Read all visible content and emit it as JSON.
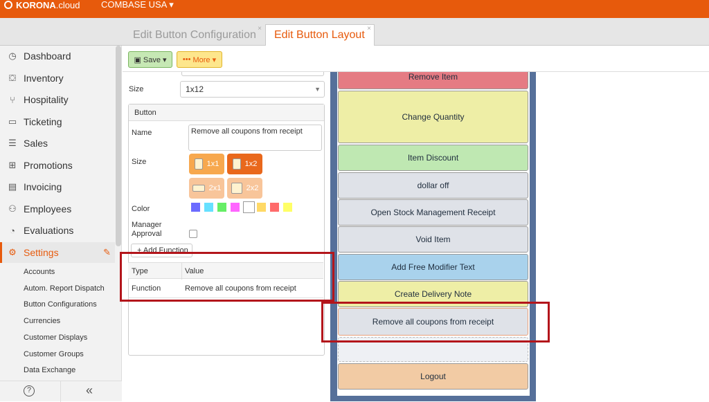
{
  "app": {
    "brand_name": "KORONA",
    "brand_suffix": ".cloud",
    "tenant": "COMBASE USA ▾"
  },
  "tabs": [
    {
      "label": "Edit Button Configuration",
      "close": "×"
    },
    {
      "label": "Edit Button Layout",
      "close": "×"
    }
  ],
  "sidebar": {
    "items": [
      {
        "label": "Dashboard",
        "icon": "dashboard-icon"
      },
      {
        "label": "Inventory",
        "icon": "inventory-icon"
      },
      {
        "label": "Hospitality",
        "icon": "hospitality-icon"
      },
      {
        "label": "Ticketing",
        "icon": "ticket-icon"
      },
      {
        "label": "Sales",
        "icon": "sales-icon"
      },
      {
        "label": "Promotions",
        "icon": "gift-icon"
      },
      {
        "label": "Invoicing",
        "icon": "invoice-icon"
      },
      {
        "label": "Employees",
        "icon": "employees-icon"
      },
      {
        "label": "Evaluations",
        "icon": "pie-chart-icon"
      },
      {
        "label": "Settings",
        "icon": "gear-icon"
      }
    ],
    "settings_subitems": [
      "Accounts",
      "Autom. Report Dispatch",
      "Button Configurations",
      "Currencies",
      "Customer Displays",
      "Customer Groups",
      "Data Exchange"
    ],
    "footer": {
      "help": "?",
      "collapse": "«"
    }
  },
  "toolbar": {
    "save_label": "Save ▾",
    "more_label": "More ▾",
    "more_dots": "•••"
  },
  "form": {
    "size_label": "Size",
    "size_value": "1x12",
    "button_section": "Button",
    "name_label": "Name",
    "name_value": "Remove all coupons from receipt",
    "button_size_label": "Size",
    "size_options": [
      "1x1",
      "1x2",
      "2x1",
      "2x2"
    ],
    "color_label": "Color",
    "colors": [
      "#6b6bff",
      "#66e0ff",
      "#66ee66",
      "#ff66ff",
      "#ffffff",
      "#ffd966",
      "#ff6b6b",
      "#ffff66"
    ],
    "manager_label_1": "Manager",
    "manager_label_2": "Approval",
    "add_function": "+ Add Function",
    "functions": {
      "headers": [
        "Type",
        "Value"
      ],
      "rows": [
        {
          "type": "Function",
          "value": "Remove all coupons from receipt"
        }
      ]
    }
  },
  "layout_buttons": [
    {
      "label": "Remove Item",
      "color": "#e57b83"
    },
    {
      "label": "Change Quantity",
      "color": "#eeeea6"
    },
    {
      "label": "Item Discount",
      "color": "#bfe8b2"
    },
    {
      "label": "dollar off",
      "color": "#dfe2e8"
    },
    {
      "label": "Open Stock Management Receipt",
      "color": "#dfe2e8"
    },
    {
      "label": "Void Item",
      "color": "#dfe2e8"
    },
    {
      "label": "Add Free Modifier Text",
      "color": "#a9d2ec"
    },
    {
      "label": "Create Delivery Note",
      "color": "#eeeea6"
    },
    {
      "label": "Remove all coupons from receipt",
      "color": "#dfe2e8"
    },
    {
      "label": "",
      "color": "#eef0f4"
    },
    {
      "label": "Logout",
      "color": "#f2cba4"
    }
  ]
}
